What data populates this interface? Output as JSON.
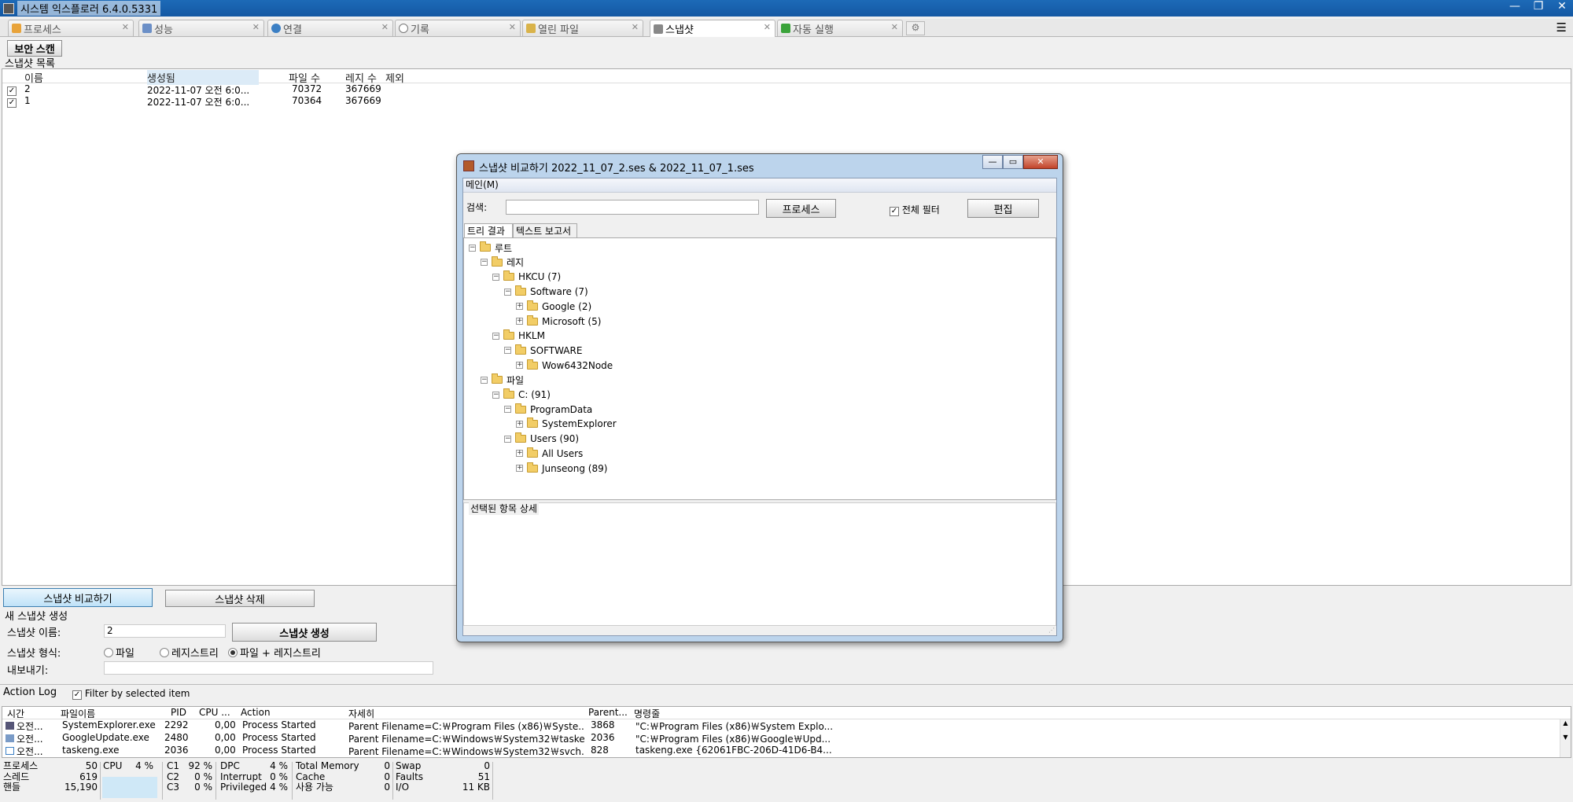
{
  "window": {
    "title": "시스템 익스플로러 6.4.0.5331"
  },
  "tabs": [
    {
      "label": "프로세스",
      "icon": "gear-icon"
    },
    {
      "label": "성능",
      "icon": "chart-icon"
    },
    {
      "label": "연결",
      "icon": "globe-icon"
    },
    {
      "label": "기록",
      "icon": "clock-icon"
    },
    {
      "label": "열린 파일",
      "icon": "file-lock-icon"
    },
    {
      "label": "스냅샷",
      "icon": "camera-icon"
    },
    {
      "label": "자동 실행",
      "icon": "arrow-icon"
    }
  ],
  "toolbar": {
    "security_scan": "보안 스캔"
  },
  "snapshot_list": {
    "label": "스냅샷 목록",
    "columns": [
      "이름",
      "생성됨",
      "파일 수",
      "레지 수",
      "제외"
    ],
    "rows": [
      {
        "name": "2",
        "created": "2022-11-07 오전 6:0...",
        "files": "70372",
        "reg": "367669",
        "checked": true
      },
      {
        "name": "1",
        "created": "2022-11-07 오전 6:0...",
        "files": "70364",
        "reg": "367669",
        "checked": true
      }
    ]
  },
  "snapshot_actions": {
    "compare": "스냅샷 비교하기",
    "delete": "스냅샷 삭제"
  },
  "new_snapshot": {
    "label": "새 스냅샷 생성",
    "name_label": "스냅샷 이름:",
    "name_value": "2",
    "create": "스냅샷 생성",
    "type_label": "스냅샷 형식:",
    "type_file": "파일",
    "type_reg": "레지스트리",
    "type_both": "파일 + 레지스트리",
    "export_label": "내보내기:"
  },
  "action_log": {
    "title": "Action Log",
    "filter": "Filter by selected item",
    "columns": [
      "시간",
      "파일이름",
      "PID",
      "CPU ...",
      "Action",
      "자세히",
      "Parent...",
      "명령줄"
    ],
    "rows": [
      {
        "time": "오전...",
        "file": "SystemExplorer.exe",
        "pid": "2292",
        "cpu": "0,00",
        "action": "Process Started",
        "detail": "Parent Filename=C:￦Program Files (x86)￦Syste...",
        "parent": "3868",
        "cmd": "\"C:￦Program Files (x86)￦System Explo..."
      },
      {
        "time": "오전...",
        "file": "GoogleUpdate.exe",
        "pid": "2480",
        "cpu": "0,00",
        "action": "Process Started",
        "detail": "Parent Filename=C:￦Windows￦System32￦taske...",
        "parent": "2036",
        "cmd": "\"C:￦Program Files (x86)￦Google￦Upd..."
      },
      {
        "time": "오전...",
        "file": "taskeng.exe",
        "pid": "2036",
        "cpu": "0,00",
        "action": "Process Started",
        "detail": "Parent Filename=C:￦Windows￦System32￦svch...",
        "parent": "828",
        "cmd": "taskeng.exe {62061FBC-206D-41D6-B4..."
      }
    ]
  },
  "status": {
    "processes_label": "프로세스",
    "processes": "50",
    "threads_label": "스레드",
    "threads": "619",
    "handles_label": "핸들",
    "handles": "15,190",
    "cpu_label": "CPU",
    "cpu": "4 %",
    "c1_label": "C1",
    "c1": "92 %",
    "c2_label": "C2",
    "c2": "0 %",
    "c3_label": "C3",
    "c3": "0 %",
    "dpc_label": "DPC",
    "dpc": "4 %",
    "interrupt_label": "Interrupt",
    "interrupt": "0 %",
    "privileged_label": "Privileged",
    "privileged": "4 %",
    "total_mem_label": "Total Memory",
    "total_mem": "0",
    "cache_label": "Cache",
    "cache": "0",
    "available_label": "사용 가능",
    "available": "0",
    "swap_label": "Swap",
    "swap": "0",
    "faults_label": "Faults",
    "faults": "51",
    "io_label": "I/O",
    "io": "11 KB"
  },
  "compare_dialog": {
    "title": "스냅샷 비교하기 2022_11_07_2.ses & 2022_11_07_1.ses",
    "menu": "메인(M)",
    "search_label": "검색:",
    "process_btn": "프로세스",
    "filter_all": "전체 필터",
    "edit_btn": "편집",
    "tab_tree": "트리 결과",
    "tab_text": "텍스트 보고서",
    "details_label": "선택된 항목 상세",
    "tree": [
      {
        "label": "루트",
        "level": 0,
        "expanded": true
      },
      {
        "label": "레지",
        "level": 1,
        "expanded": true
      },
      {
        "label": "HKCU (7)",
        "level": 2,
        "expanded": true
      },
      {
        "label": "Software (7)",
        "level": 3,
        "expanded": true
      },
      {
        "label": "Google (2)",
        "level": 4,
        "expanded": false
      },
      {
        "label": "Microsoft (5)",
        "level": 4,
        "expanded": false
      },
      {
        "label": "HKLM",
        "level": 2,
        "expanded": true
      },
      {
        "label": "SOFTWARE",
        "level": 3,
        "expanded": true
      },
      {
        "label": "Wow6432Node",
        "level": 4,
        "expanded": false
      },
      {
        "label": "파일",
        "level": 1,
        "expanded": true
      },
      {
        "label": "C: (91)",
        "level": 2,
        "expanded": true
      },
      {
        "label": "ProgramData",
        "level": 3,
        "expanded": true
      },
      {
        "label": "SystemExplorer",
        "level": 4,
        "expanded": false
      },
      {
        "label": "Users (90)",
        "level": 3,
        "expanded": true
      },
      {
        "label": "All Users",
        "level": 4,
        "expanded": false
      },
      {
        "label": "Junseong (89)",
        "level": 4,
        "expanded": false
      }
    ]
  }
}
